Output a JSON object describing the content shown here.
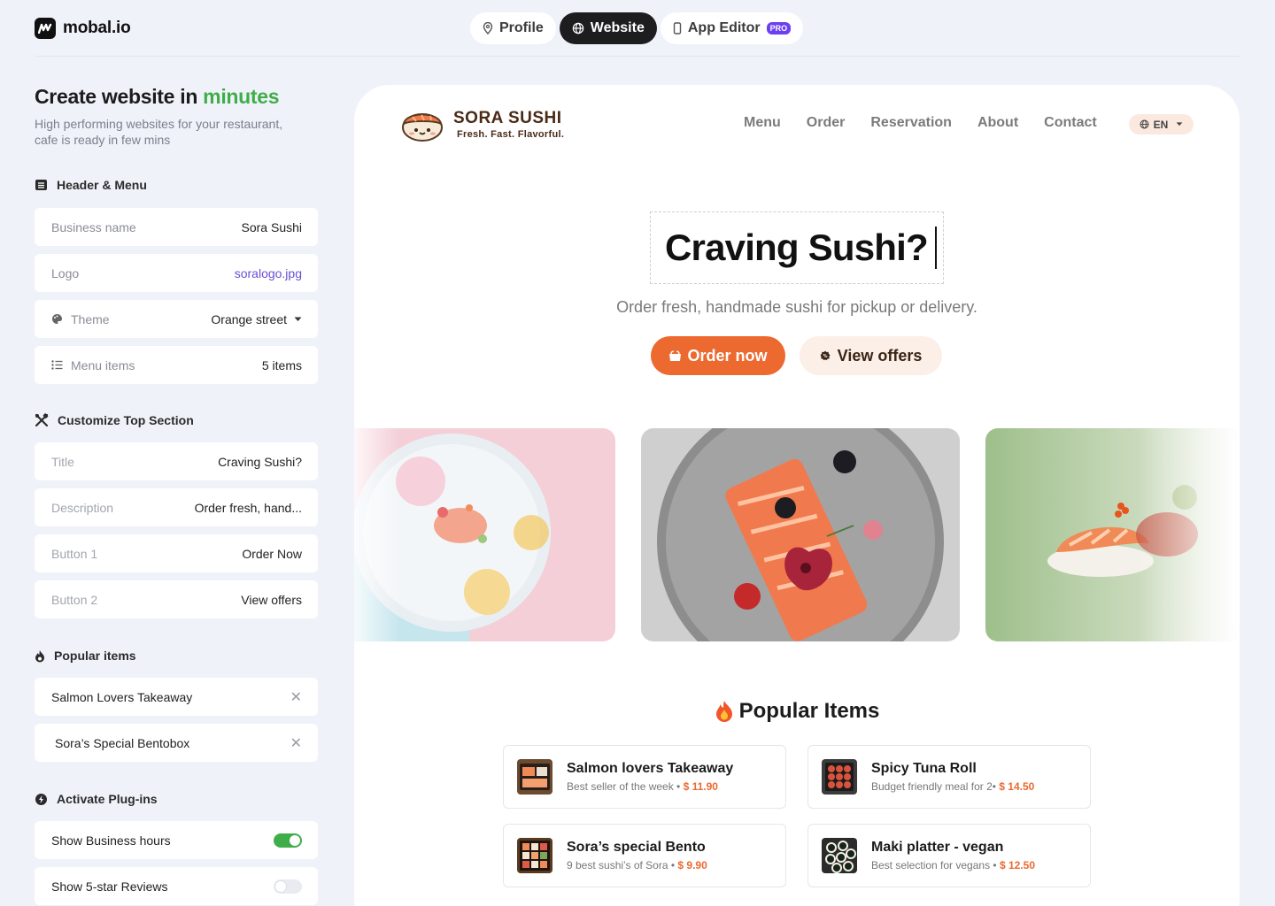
{
  "app": {
    "name": "mobal.io"
  },
  "tabs": [
    {
      "label": "Profile",
      "icon": "pin-icon"
    },
    {
      "label": "Website",
      "icon": "globe-icon",
      "active": true
    },
    {
      "label": "App Editor",
      "icon": "phone-icon",
      "badge": "PRO"
    }
  ],
  "sidebar": {
    "heading_start": "Create website in",
    "heading_highlight": "minutes",
    "subtitle": "High performing websites for your restaurant, cafe is ready in few mins",
    "header_section": {
      "title": "Header & Menu",
      "fields": [
        {
          "key": "Business name",
          "value": "Sora Sushi"
        },
        {
          "key": "Logo",
          "value": "soralogo.jpg"
        },
        {
          "key": "Theme",
          "value": "Orange street"
        },
        {
          "key": "Menu items",
          "value": "5 items"
        }
      ]
    },
    "top_section": {
      "title": "Customize Top Section",
      "fields": [
        {
          "key": "Title",
          "value": "Craving Sushi?"
        },
        {
          "key": "Description",
          "value": "Order fresh, hand..."
        },
        {
          "key": "Button 1",
          "value": "Order Now"
        },
        {
          "key": "Button 2",
          "value": "View offers"
        }
      ]
    },
    "popular_section": {
      "title": "Popular items",
      "items": [
        "Salmon Lovers Takeaway",
        "Sora’s Special Bentobox"
      ]
    },
    "plugins_section": {
      "title": "Activate Plug-ins",
      "items": [
        {
          "label": "Show Business hours",
          "enabled": true
        },
        {
          "label": "Show 5-star Reviews",
          "enabled": false
        }
      ]
    }
  },
  "preview": {
    "brand_name": "SORA SUSHI",
    "brand_tagline": "Fresh. Fast. Flavorful.",
    "nav": [
      "Menu",
      "Order",
      "Reservation",
      "About",
      "Contact"
    ],
    "language": "EN",
    "hero_title": "Craving Sushi?",
    "hero_description": "Order fresh, handmade sushi for pickup or delivery.",
    "button1": "Order now",
    "button2": "View offers",
    "popular_title": "Popular Items",
    "popular_items": [
      {
        "name": "Salmon lovers Takeaway",
        "desc": "Best seller of the week •",
        "price": "$ 11.90"
      },
      {
        "name": "Spicy Tuna Roll",
        "desc": "Budget friendly meal for 2•",
        "price": "$ 14.50"
      },
      {
        "name": "Sora’s special Bento",
        "desc": "9 best sushi’s of Sora •",
        "price": "$ 9.90"
      },
      {
        "name": "Maki platter - vegan",
        "desc": "Best selection for vegans •",
        "price": "$ 12.50"
      }
    ]
  },
  "colors": {
    "accent": "#ec6930",
    "green": "#3fae49",
    "pro": "#6d3ff0"
  }
}
